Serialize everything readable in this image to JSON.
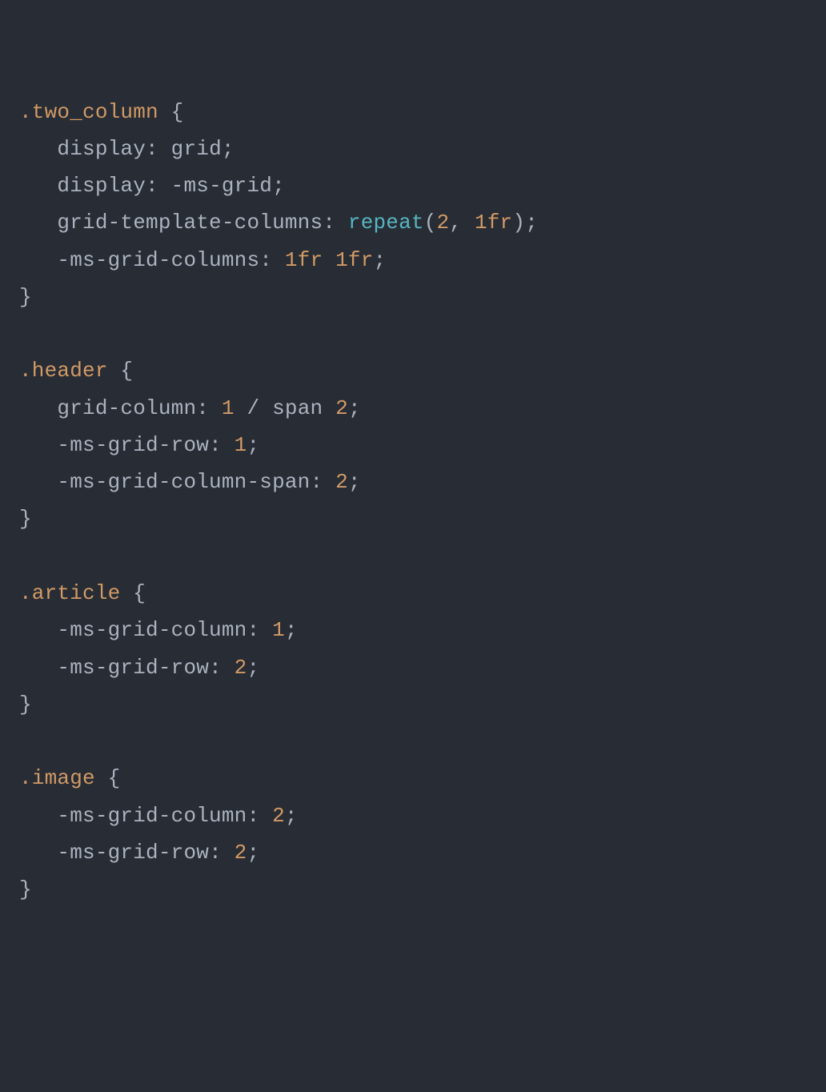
{
  "code": {
    "rule1": {
      "selector": ".two_column",
      "open": " {",
      "indent": "   ",
      "d1_prop": "display",
      "d1_colon": ": ",
      "d1_val": "grid",
      "d1_semi": ";",
      "d2_prop": "display",
      "d2_colon": ": ",
      "d2_val": "-ms-grid",
      "d2_semi": ";",
      "d3_prop": "grid-template-columns",
      "d3_colon": ": ",
      "d3_func": "repeat",
      "d3_lpar": "(",
      "d3_arg1": "2",
      "d3_comma": ", ",
      "d3_arg2": "1fr",
      "d3_rpar": ")",
      "d3_semi": ";",
      "d4_prop": "-ms-grid-columns",
      "d4_colon": ": ",
      "d4_val1": "1fr",
      "d4_sp": " ",
      "d4_val2": "1fr",
      "d4_semi": ";",
      "close": "}"
    },
    "rule2": {
      "selector": ".header",
      "open": " {",
      "indent": "   ",
      "d1_prop": "grid-column",
      "d1_colon": ": ",
      "d1_v1": "1",
      "d1_slash": " / ",
      "d1_span": "span",
      "d1_sp": " ",
      "d1_v2": "2",
      "d1_semi": ";",
      "d2_prop": "-ms-grid-row",
      "d2_colon": ": ",
      "d2_v": "1",
      "d2_semi": ";",
      "d3_prop": "-ms-grid-column-span",
      "d3_colon": ": ",
      "d3_v": "2",
      "d3_semi": ";",
      "close": "}"
    },
    "rule3": {
      "selector": ".article",
      "open": " {",
      "indent": "   ",
      "d1_prop": "-ms-grid-column",
      "d1_colon": ": ",
      "d1_v": "1",
      "d1_semi": ";",
      "d2_prop": "-ms-grid-row",
      "d2_colon": ": ",
      "d2_v": "2",
      "d2_semi": ";",
      "close": "}"
    },
    "rule4": {
      "selector": ".image",
      "open": " {",
      "indent": "   ",
      "d1_prop": "-ms-grid-column",
      "d1_colon": ": ",
      "d1_v": "2",
      "d1_semi": ";",
      "d2_prop": "-ms-grid-row",
      "d2_colon": ": ",
      "d2_v": "2",
      "d2_semi": ";",
      "close": "}"
    }
  }
}
